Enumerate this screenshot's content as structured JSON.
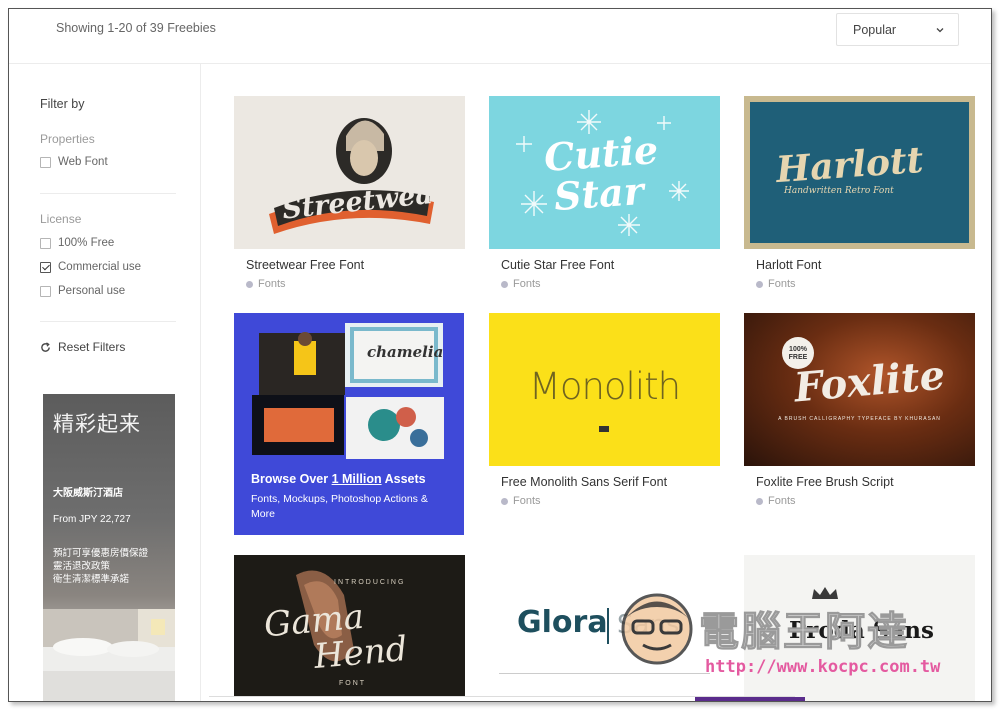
{
  "header": {
    "result_count": "Showing 1-20 of 39 Freebies",
    "sort_selected": "Popular"
  },
  "sidebar": {
    "filter_title": "Filter by",
    "groups": [
      {
        "title": "Properties",
        "options": [
          {
            "label": "Web Font",
            "checked": false
          }
        ]
      },
      {
        "title": "License",
        "options": [
          {
            "label": "100% Free",
            "checked": false
          },
          {
            "label": "Commercial use",
            "checked": true
          },
          {
            "label": "Personal use",
            "checked": false
          }
        ]
      }
    ],
    "reset_label": "Reset Filters"
  },
  "ad": {
    "headline": "精彩起来",
    "hotel": "大阪威斯汀酒店",
    "price": "From JPY 22,727",
    "lines": [
      "預訂可享優惠房價保證",
      "靈活退改政策",
      "衛生清潔標準承諾"
    ]
  },
  "cards": [
    {
      "title": "Streetwear Free Font",
      "category": "Fonts",
      "thumb_text": "Streetwear"
    },
    {
      "title": "Cutie Star Free Font",
      "category": "Fonts",
      "thumb_text_1": "Cutie",
      "thumb_text_2": "Star"
    },
    {
      "title": "Harlott Font",
      "category": "Fonts",
      "thumb_text": "Harlott",
      "thumb_sub": "Handwritten Retro Font"
    },
    {
      "title": "Free Monolith Sans Serif Font",
      "category": "Fonts",
      "thumb_text": "Monolith"
    },
    {
      "title": "Foxlite Free Brush Script",
      "category": "Fonts",
      "thumb_text": "Foxlite",
      "thumb_badge": "100% FREE",
      "thumb_sub": "A BRUSH CALLIGRAPHY TYPEFACE BY KHURASAN"
    },
    {
      "title": "",
      "category": "",
      "thumb_text_1": "Gama",
      "thumb_text_2": "Hend",
      "thumb_top": "INTRODUCING",
      "thumb_bottom": "FONT"
    },
    {
      "title": "",
      "category": "",
      "thumb_text": "Glora",
      "thumb_text_2": "Sans"
    },
    {
      "title": "",
      "category": "",
      "thumb_text": "Proda Sans"
    }
  ],
  "promo": {
    "title_prefix": "Browse Over ",
    "title_link": "1 Million",
    "title_suffix": " Assets",
    "subtitle": "Fonts, Mockups, Photoshop Actions & More",
    "mockup_text": "chamelia"
  },
  "watermark": {
    "title": "電腦王阿達",
    "url": "http://www.kocpc.com.tw"
  },
  "colors": {
    "promo_bg": "#3f49d8",
    "cutie_bg": "#7dd6e0",
    "harlott_bg": "#1f5f78",
    "monolith_bg": "#fbe019",
    "check_mark": "#333333"
  },
  "icons": {
    "sort": "chevron-down-icon",
    "reset": "refresh-icon",
    "category": "dot-icon"
  }
}
